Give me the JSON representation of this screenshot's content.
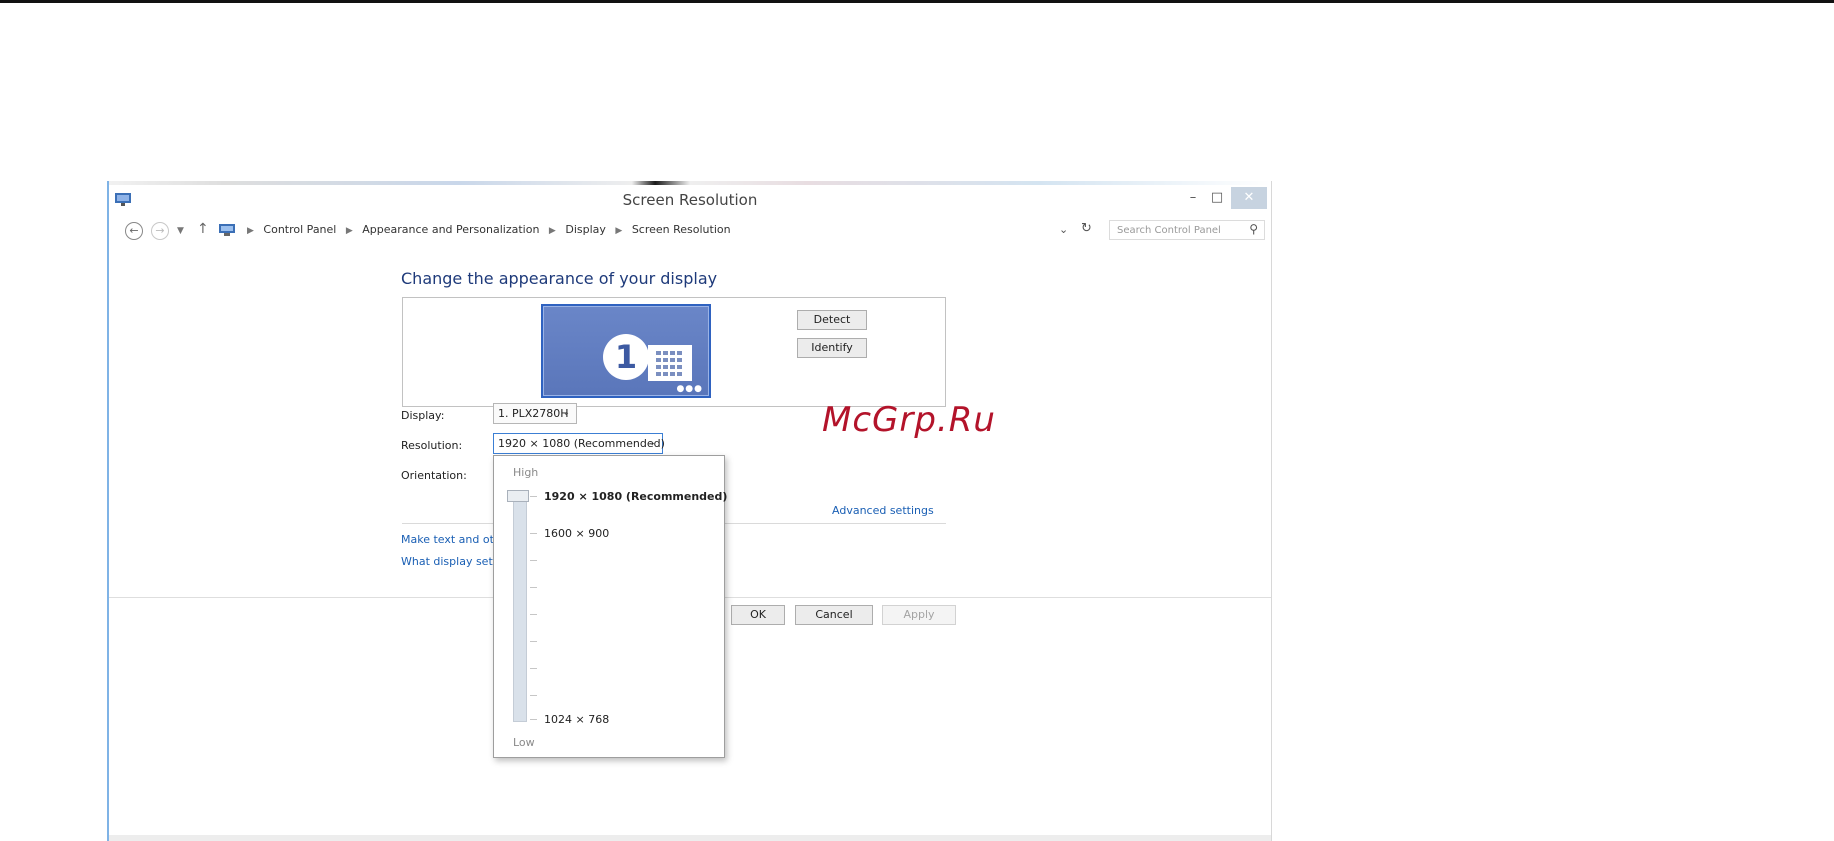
{
  "window": {
    "title": "Screen Resolution",
    "controls": {
      "minimize": "–",
      "maximize": "□",
      "close": "✕"
    }
  },
  "navigation": {
    "breadcrumb": [
      "Control Panel",
      "Appearance and Personalization",
      "Display",
      "Screen Resolution"
    ],
    "search_placeholder": "Search Control Panel",
    "icons": [
      "back-arrow-icon",
      "forward-arrow-icon",
      "recent-locations-icon",
      "up-arrow-icon",
      "control-panel-icon",
      "refresh-icon",
      "search-icon"
    ]
  },
  "main": {
    "heading": "Change the appearance of your display",
    "monitor_number": "1",
    "detect_label": "Detect",
    "identify_label": "Identify",
    "display_label": "Display:",
    "display_value": "1. PLX2780H",
    "resolution_label": "Resolution:",
    "resolution_value": "1920 × 1080 (Recommended)",
    "orientation_label": "Orientation:",
    "advanced_link": "Advanced settings",
    "text_size_link": "Make text and other",
    "display_settings_link": "What display setting"
  },
  "footer": {
    "ok_label": "OK",
    "cancel_label": "Cancel",
    "apply_label": "Apply"
  },
  "resolution_popup": {
    "high_label": "High",
    "low_label": "Low",
    "options": [
      "1920 × 1080 (Recommended)",
      "1600 × 900",
      "1024 × 768"
    ],
    "selected_fraction": 1.0
  },
  "watermark": "McGrp.Ru",
  "colors": {
    "accent": "#1e3a7a",
    "link": "#1a5fb4",
    "monitor": "#5a76ba",
    "watermark": "#b3132a"
  }
}
